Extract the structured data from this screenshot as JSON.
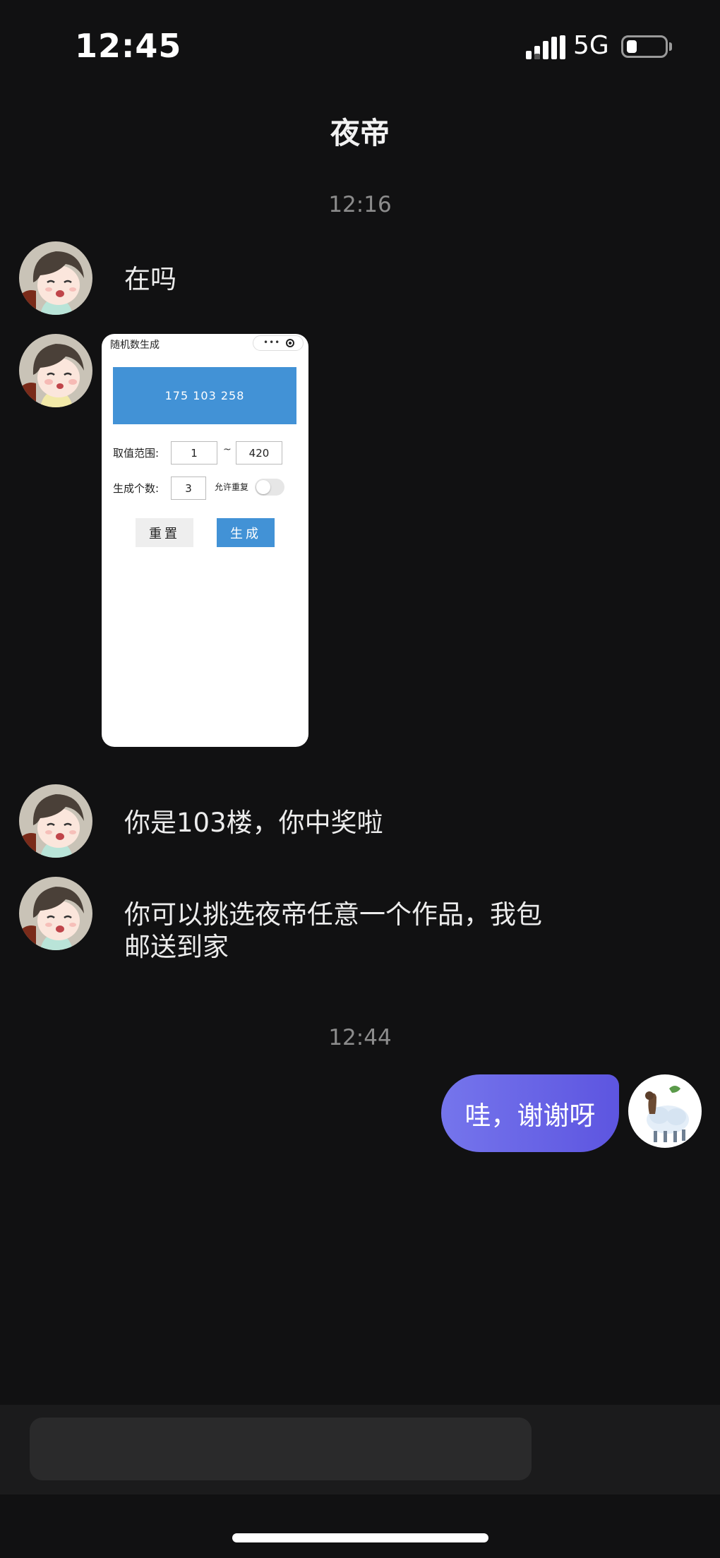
{
  "status_bar": {
    "time": "12:45",
    "network": "5G",
    "icons": [
      "signal-icon",
      "battery-icon"
    ]
  },
  "header": {
    "title": "夜帝"
  },
  "messages": {
    "timestamp_1": "12:16",
    "msg_1": "在吗",
    "screenshot": {
      "title": "随机数生成",
      "capsule_dots": "•••",
      "result": "175  103  258",
      "range_label": "取值范围:",
      "range_min": "1",
      "range_sep": "~",
      "range_max": "420",
      "count_label": "生成个数:",
      "count_value": "3",
      "allow_repeat_label": "允许重复",
      "reset_button": "重置",
      "generate_button": "生成",
      "colors": {
        "primary": "#4292d6",
        "reset_bg": "#eeeeee"
      }
    },
    "msg_2": "你是103楼，你中奖啦",
    "msg_3_line_1": "你可以挑选夜帝任意一个作品，我包",
    "msg_3_line_2": "邮送到家",
    "timestamp_2": "12:44",
    "msg_out": "哇，谢谢呀"
  },
  "theme": {
    "background": "#111112",
    "bubble_gradient_start": "#7575ec",
    "bubble_gradient_end": "#5d55e0"
  }
}
